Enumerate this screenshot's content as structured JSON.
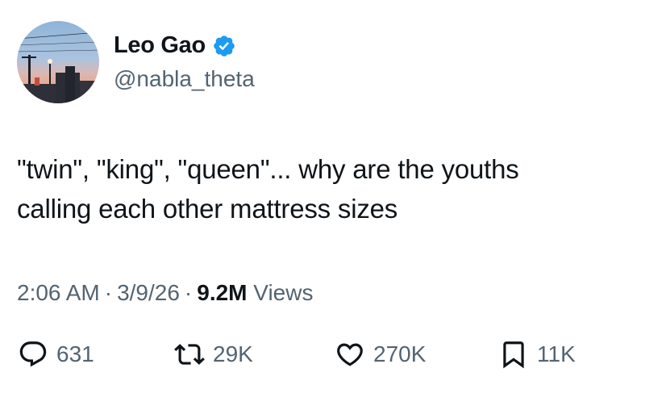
{
  "user": {
    "display_name": "Leo Gao",
    "handle": "@nabla_theta",
    "verified": true,
    "verified_icon": "verified-badge-icon",
    "verified_color": "#1d9bf0"
  },
  "tweet": {
    "lines": [
      "\"twin\", \"king\", \"queen\"... why are the youths",
      "calling each other mattress sizes"
    ]
  },
  "meta": {
    "time": "2:06 AM",
    "separator": "·",
    "date": "3/9/26",
    "views_count": "9.2M",
    "views_label": "Views"
  },
  "actions": {
    "replies": {
      "icon": "reply-icon",
      "count": "631"
    },
    "retweets": {
      "icon": "retweet-icon",
      "count": "29K"
    },
    "likes": {
      "icon": "heart-icon",
      "count": "270K"
    },
    "bookmarks": {
      "icon": "bookmark-icon",
      "count": "11K"
    }
  },
  "colors": {
    "text": "#0f1419",
    "secondary": "#536471"
  }
}
